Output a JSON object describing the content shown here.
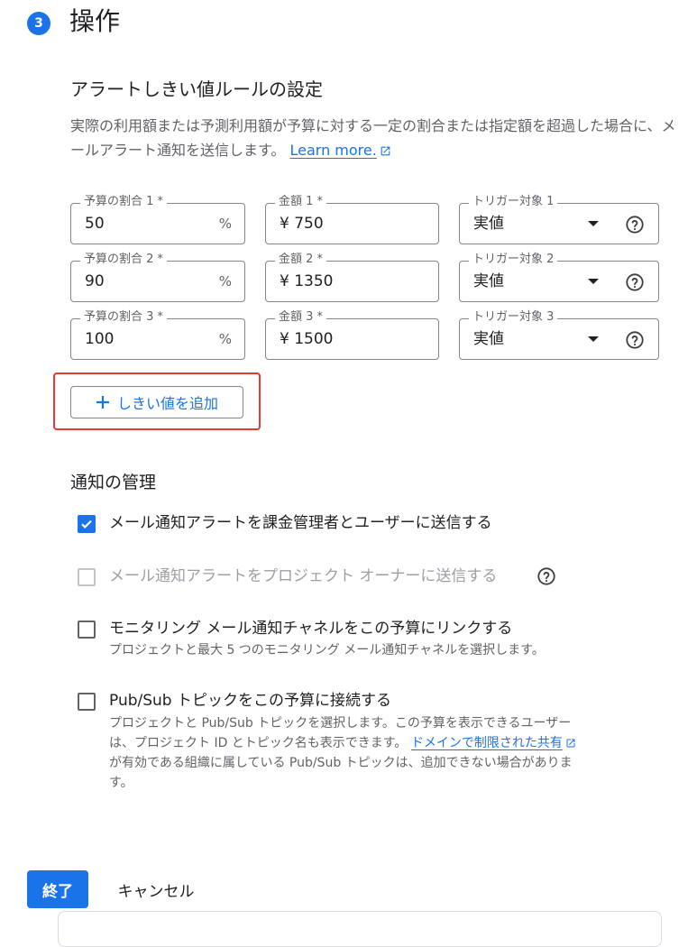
{
  "step": {
    "number": "3",
    "title": "操作"
  },
  "alert_rules": {
    "title": "アラートしきい値ルールの設定",
    "description": "実際の利用額または予測利用額が予算に対する一定の割合または指定額を超過した場合に、メールアラート通知を送信します。",
    "learn_more": "Learn more.",
    "rows": [
      {
        "percent_label": "予算の割合 1 *",
        "percent_value": "50",
        "percent_suffix": "%",
        "amount_label": "金額 1 *",
        "amount_value": "¥ 750",
        "trigger_label": "トリガー対象 1",
        "trigger_value": "実値"
      },
      {
        "percent_label": "予算の割合 2 *",
        "percent_value": "90",
        "percent_suffix": "%",
        "amount_label": "金額 2 *",
        "amount_value": "¥ 1350",
        "trigger_label": "トリガー対象 2",
        "trigger_value": "実値"
      },
      {
        "percent_label": "予算の割合 3 *",
        "percent_value": "100",
        "percent_suffix": "%",
        "amount_label": "金額 3 *",
        "amount_value": "¥ 1500",
        "trigger_label": "トリガー対象 3",
        "trigger_value": "実値"
      }
    ],
    "add_threshold_label": "しきい値を追加"
  },
  "notifications": {
    "title": "通知の管理",
    "options": [
      {
        "label": "メール通知アラートを課金管理者とユーザーに送信する",
        "state": "checked"
      },
      {
        "label": "メール通知アラートをプロジェクト オーナーに送信する",
        "state": "disabled"
      },
      {
        "label": "モニタリング メール通知チャネルをこの予算にリンクする",
        "state": "unchecked",
        "description": "プロジェクトと最大 5 つのモニタリング メール通知チャネルを選択します。"
      },
      {
        "label": "Pub/Sub トピックをこの予算に接続する",
        "state": "unchecked",
        "description_line1": "プロジェクトと Pub/Sub トピックを選択します。この予算を表示できるユーザー",
        "description_line2": "は、プロジェクト ID とトピック名も表示できます。",
        "description_link": "ドメインで制限された共有",
        "description_line3": "が有効である組織に属している Pub/Sub トピックは、追加できない場合がありま",
        "description_line4": "す。"
      }
    ]
  },
  "actions": {
    "done": "終了",
    "cancel": "キャンセル"
  },
  "colors": {
    "accent": "#1a73e8",
    "highlight": "#e53935",
    "text_secondary": "#5f6368"
  },
  "icons": [
    "external-link-icon",
    "dropdown-arrow-icon",
    "help-icon",
    "plus-icon",
    "checkmark-icon"
  ]
}
